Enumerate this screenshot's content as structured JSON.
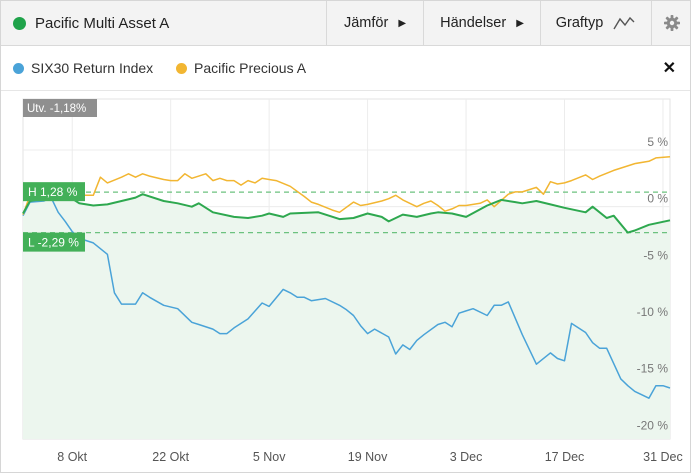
{
  "header": {
    "title": "Pacific Multi Asset A",
    "title_dot_color": "#1fa34a",
    "compare_label": "Jämför",
    "events_label": "Händelser",
    "charttype_label": "Graftyp",
    "charttype_icon": "line-chart-icon",
    "settings_icon": "gear-icon"
  },
  "legend": {
    "items": [
      {
        "label": "SIX30 Return Index",
        "color": "#4aa3d8"
      },
      {
        "label": "Pacific Precious A",
        "color": "#f2b632"
      }
    ],
    "close_symbol": "✕"
  },
  "chart_data": {
    "type": "line",
    "change_label": "Utv. -1,18%",
    "high_label": "H 1,28 %",
    "low_label": "L -2,29 %",
    "high_value": 1.28,
    "low_value": -2.29,
    "x_ticks": [
      "8 Okt",
      "22 Okt",
      "5 Nov",
      "19 Nov",
      "3 Dec",
      "17 Dec",
      "31 Dec"
    ],
    "y_ticks": [
      {
        "value": 5,
        "label": "5 %"
      },
      {
        "value": 0,
        "label": "0 %"
      },
      {
        "value": -5,
        "label": "-5 %"
      },
      {
        "value": -10,
        "label": "-10 %"
      },
      {
        "value": -15,
        "label": "-15 %"
      },
      {
        "value": -20,
        "label": "-20 %"
      }
    ],
    "x_range": [
      -7,
      85
    ],
    "y_range": [
      -20.5,
      9.5
    ],
    "grid": true,
    "series": [
      {
        "name": "Pacific Multi Asset A",
        "color": "#2ea84f",
        "fill": true,
        "x": [
          -7,
          -6,
          -4,
          -3,
          -2,
          0,
          1,
          3,
          5,
          7,
          9,
          10,
          13,
          15,
          17,
          18,
          20,
          23,
          25,
          27,
          28,
          30,
          31,
          35,
          38,
          40,
          42,
          44,
          45,
          47,
          49,
          51,
          52,
          54,
          56,
          59,
          61,
          63,
          64,
          66,
          68,
          70,
          73,
          74,
          76,
          77,
          79,
          80,
          82,
          85
        ],
        "y": [
          -0.6,
          0.5,
          0.7,
          1.28,
          0.9,
          0.7,
          0.3,
          0.1,
          0.2,
          0.5,
          0.8,
          1.1,
          0.5,
          0.3,
          0.0,
          0.3,
          -0.5,
          -0.9,
          -1.0,
          -0.8,
          -0.6,
          -0.9,
          -0.6,
          -0.5,
          -1.1,
          -1.0,
          -0.6,
          -0.9,
          -1.3,
          -0.7,
          -0.9,
          -0.6,
          -0.5,
          -0.6,
          -0.9,
          0.1,
          0.6,
          0.4,
          0.3,
          0.5,
          0.2,
          -0.1,
          -0.5,
          0.0,
          -1.0,
          -0.8,
          -2.29,
          -2.1,
          -1.6,
          -1.2
        ]
      },
      {
        "name": "SIX30 Return Index",
        "color": "#4aa3d8",
        "x": [
          -7,
          -6,
          -4,
          -3,
          -2,
          -1,
          0,
          1,
          3,
          5,
          6,
          7,
          8,
          9,
          10,
          11,
          13,
          15,
          17,
          18,
          20,
          21,
          22,
          23,
          25,
          27,
          28,
          30,
          31,
          32,
          33,
          34,
          36,
          38,
          39,
          40,
          41,
          42,
          43,
          45,
          46,
          47,
          48,
          49,
          50,
          52,
          53,
          54,
          55,
          56,
          57,
          59,
          60,
          61,
          62,
          64,
          66,
          68,
          69,
          70,
          71,
          73,
          74,
          75,
          76,
          78,
          79,
          80,
          81,
          82,
          83,
          84,
          85
        ],
        "y": [
          -0.8,
          0.4,
          0.5,
          0.8,
          -0.5,
          -1.3,
          -2.2,
          -2.8,
          -3.2,
          -4.2,
          -7.6,
          -8.6,
          -8.6,
          -8.6,
          -7.6,
          -8.0,
          -8.7,
          -9.0,
          -10.2,
          -10.4,
          -10.8,
          -11.2,
          -11.2,
          -10.7,
          -9.9,
          -8.5,
          -8.8,
          -7.3,
          -7.6,
          -8.0,
          -8.0,
          -8.3,
          -8.1,
          -8.7,
          -9.1,
          -9.6,
          -10.5,
          -11.2,
          -10.8,
          -11.5,
          -13.0,
          -12.2,
          -12.6,
          -11.8,
          -11.3,
          -10.4,
          -10.2,
          -10.6,
          -9.4,
          -9.2,
          -9.0,
          -9.6,
          -8.7,
          -8.7,
          -8.4,
          -11.3,
          -13.9,
          -12.9,
          -13.4,
          -13.6,
          -10.3,
          -11.1,
          -12.0,
          -12.5,
          -12.5,
          -15.2,
          -15.8,
          -16.3,
          -16.6,
          -16.9,
          -15.8,
          -15.8,
          -16.0
        ]
      },
      {
        "name": "Pacific Precious A",
        "color": "#f2b632",
        "x": [
          -7,
          -6,
          -4,
          -3,
          -2,
          -1,
          0,
          1,
          3,
          4,
          5,
          7,
          8,
          9,
          10,
          11,
          13,
          14,
          15,
          16,
          17,
          19,
          20,
          21,
          22,
          23,
          24,
          25,
          26,
          27,
          28,
          29,
          31,
          33,
          34,
          35,
          37,
          38,
          40,
          41,
          42,
          44,
          45,
          46,
          47,
          49,
          50,
          51,
          52,
          53,
          54,
          55,
          56,
          58,
          59,
          60,
          62,
          63,
          64,
          66,
          67,
          68,
          69,
          70,
          71,
          73,
          74,
          75,
          77,
          79,
          80,
          82,
          83,
          85
        ],
        "y": [
          -0.7,
          1.0,
          1.6,
          2.0,
          1.7,
          1.4,
          1.1,
          1.0,
          1.0,
          2.6,
          2.1,
          2.6,
          2.9,
          2.6,
          2.9,
          2.7,
          2.4,
          2.3,
          2.3,
          2.9,
          2.5,
          2.9,
          2.3,
          2.5,
          2.3,
          2.3,
          1.9,
          2.3,
          2.1,
          2.5,
          2.4,
          2.3,
          1.8,
          0.9,
          0.4,
          0.2,
          -0.3,
          -0.5,
          0.4,
          0.1,
          0.2,
          0.5,
          0.7,
          1.0,
          0.6,
          0.0,
          0.3,
          0.5,
          0.1,
          -0.4,
          -0.2,
          0.1,
          0.1,
          0.3,
          0.6,
          0.0,
          1.1,
          1.3,
          1.3,
          1.7,
          1.1,
          2.2,
          2.0,
          2.1,
          2.3,
          2.8,
          2.4,
          2.7,
          3.2,
          3.6,
          3.8,
          4.0,
          4.3,
          4.4
        ]
      }
    ]
  }
}
